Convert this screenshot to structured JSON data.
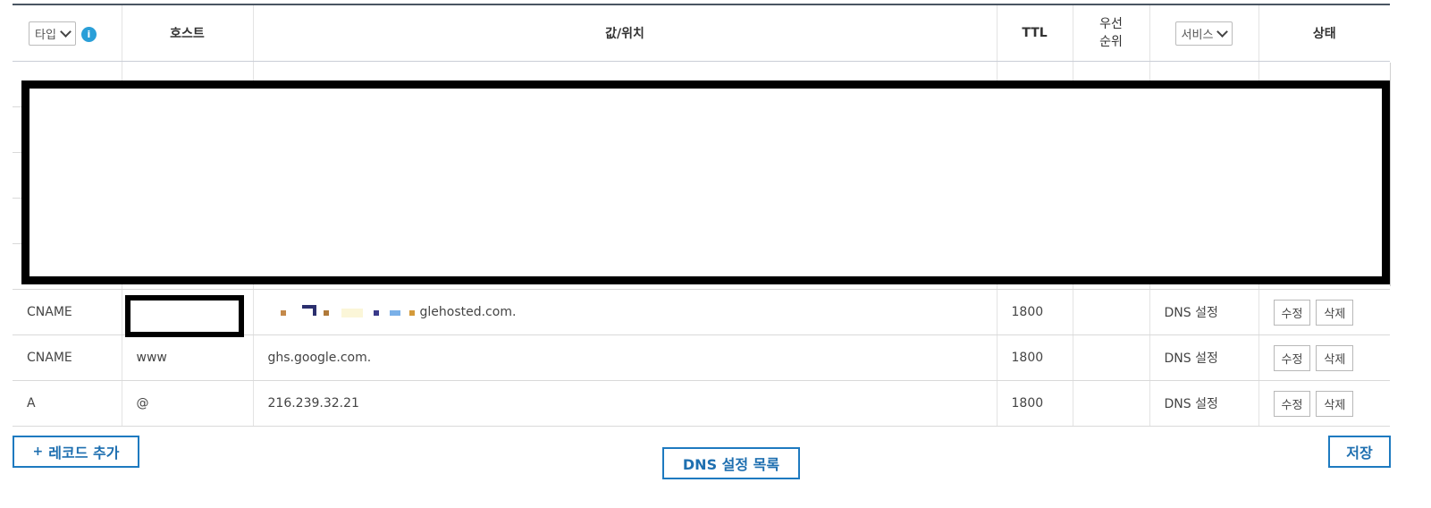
{
  "columns": {
    "type_label": "타입",
    "info_icon": "i",
    "host": "호스트",
    "value": "값/위치",
    "ttl": "TTL",
    "priority": "우선\n순위",
    "service_label": "서비스",
    "status": "상태"
  },
  "rows": [
    {
      "type": "CNAME",
      "host": "",
      "value": "glehosted.com.",
      "ttl": "1800",
      "priority": "",
      "service": "DNS 설정",
      "edit": "수정",
      "delete": "삭제"
    },
    {
      "type": "CNAME",
      "host": "www",
      "value": "ghs.google.com.",
      "ttl": "1800",
      "priority": "",
      "service": "DNS 설정",
      "edit": "수정",
      "delete": "삭제"
    },
    {
      "type": "A",
      "host": "@",
      "value": "216.239.32.21",
      "ttl": "1800",
      "priority": "",
      "service": "DNS 설정",
      "edit": "수정",
      "delete": "삭제"
    }
  ],
  "actions": {
    "add_record_plus": "+",
    "add_record": "레코드 추가",
    "dns_list": "DNS 설정 목록",
    "save": "저장"
  },
  "colors": {
    "accent": "#1e7ac0",
    "info": "#2a9fd8",
    "header_line": "#4a5563"
  },
  "icons": {
    "info": "info-icon",
    "dropdown": "chevron-down-icon"
  }
}
